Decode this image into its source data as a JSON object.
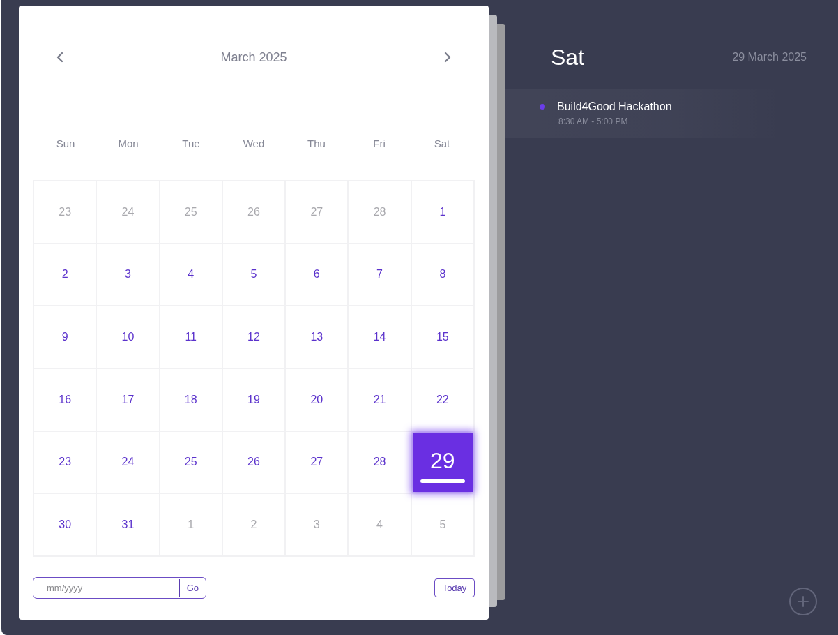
{
  "calendar": {
    "month_label": "March 2025",
    "weekdays": [
      "Sun",
      "Mon",
      "Tue",
      "Wed",
      "Thu",
      "Fri",
      "Sat"
    ],
    "weeks": [
      [
        {
          "day": "23",
          "in_month": false,
          "selected": false
        },
        {
          "day": "24",
          "in_month": false,
          "selected": false
        },
        {
          "day": "25",
          "in_month": false,
          "selected": false
        },
        {
          "day": "26",
          "in_month": false,
          "selected": false
        },
        {
          "day": "27",
          "in_month": false,
          "selected": false
        },
        {
          "day": "28",
          "in_month": false,
          "selected": false
        },
        {
          "day": "1",
          "in_month": true,
          "selected": false
        }
      ],
      [
        {
          "day": "2",
          "in_month": true,
          "selected": false
        },
        {
          "day": "3",
          "in_month": true,
          "selected": false
        },
        {
          "day": "4",
          "in_month": true,
          "selected": false
        },
        {
          "day": "5",
          "in_month": true,
          "selected": false
        },
        {
          "day": "6",
          "in_month": true,
          "selected": false
        },
        {
          "day": "7",
          "in_month": true,
          "selected": false
        },
        {
          "day": "8",
          "in_month": true,
          "selected": false
        }
      ],
      [
        {
          "day": "9",
          "in_month": true,
          "selected": false
        },
        {
          "day": "10",
          "in_month": true,
          "selected": false
        },
        {
          "day": "11",
          "in_month": true,
          "selected": false
        },
        {
          "day": "12",
          "in_month": true,
          "selected": false
        },
        {
          "day": "13",
          "in_month": true,
          "selected": false
        },
        {
          "day": "14",
          "in_month": true,
          "selected": false
        },
        {
          "day": "15",
          "in_month": true,
          "selected": false
        }
      ],
      [
        {
          "day": "16",
          "in_month": true,
          "selected": false
        },
        {
          "day": "17",
          "in_month": true,
          "selected": false
        },
        {
          "day": "18",
          "in_month": true,
          "selected": false
        },
        {
          "day": "19",
          "in_month": true,
          "selected": false
        },
        {
          "day": "20",
          "in_month": true,
          "selected": false
        },
        {
          "day": "21",
          "in_month": true,
          "selected": false
        },
        {
          "day": "22",
          "in_month": true,
          "selected": false
        }
      ],
      [
        {
          "day": "23",
          "in_month": true,
          "selected": false
        },
        {
          "day": "24",
          "in_month": true,
          "selected": false
        },
        {
          "day": "25",
          "in_month": true,
          "selected": false
        },
        {
          "day": "26",
          "in_month": true,
          "selected": false
        },
        {
          "day": "27",
          "in_month": true,
          "selected": false
        },
        {
          "day": "28",
          "in_month": true,
          "selected": false
        },
        {
          "day": "29",
          "in_month": true,
          "selected": true
        }
      ],
      [
        {
          "day": "30",
          "in_month": true,
          "selected": false
        },
        {
          "day": "31",
          "in_month": true,
          "selected": false
        },
        {
          "day": "1",
          "in_month": false,
          "selected": false
        },
        {
          "day": "2",
          "in_month": false,
          "selected": false
        },
        {
          "day": "3",
          "in_month": false,
          "selected": false
        },
        {
          "day": "4",
          "in_month": false,
          "selected": false
        },
        {
          "day": "5",
          "in_month": false,
          "selected": false
        }
      ]
    ],
    "jump": {
      "placeholder": "mm/yyyy",
      "go_label": "Go"
    },
    "today_label": "Today"
  },
  "day_panel": {
    "weekday": "Sat",
    "date": "29 March 2025",
    "events": [
      {
        "title": "Build4Good Hackathon",
        "time": "8:30 AM - 5:00 PM",
        "color": "#6a3de8"
      }
    ]
  }
}
